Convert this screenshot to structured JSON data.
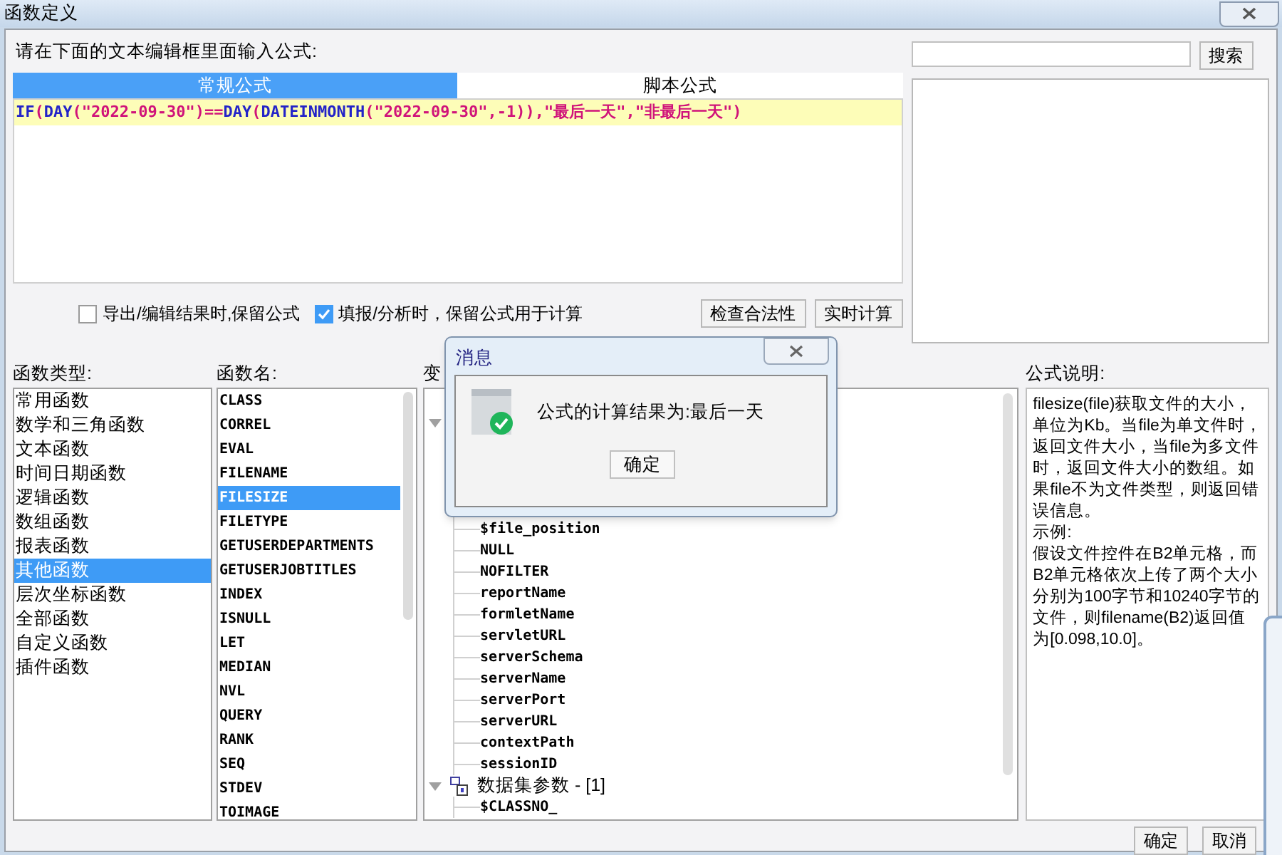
{
  "window": {
    "title": "函数定义"
  },
  "prompt": "请在下面的文本编辑框里面输入公式:",
  "tabs": [
    {
      "label": "常规公式",
      "selected": true
    },
    {
      "label": "脚本公式",
      "selected": false
    }
  ],
  "formula": [
    {
      "kind": "keyword",
      "text": "IF"
    },
    {
      "kind": "symbol",
      "text": "("
    },
    {
      "kind": "keyword",
      "text": "DAY"
    },
    {
      "kind": "symbol",
      "text": "("
    },
    {
      "kind": "string",
      "text": "\"2022-09-30\""
    },
    {
      "kind": "symbol",
      "text": ")=="
    },
    {
      "kind": "keyword",
      "text": "DAY"
    },
    {
      "kind": "symbol",
      "text": "("
    },
    {
      "kind": "keyword",
      "text": "DATEINMONTH"
    },
    {
      "kind": "symbol",
      "text": "("
    },
    {
      "kind": "string",
      "text": "\"2022-09-30\""
    },
    {
      "kind": "symbol",
      "text": ",-1)),"
    },
    {
      "kind": "string",
      "text": "\"最后一天\""
    },
    {
      "kind": "symbol",
      "text": ","
    },
    {
      "kind": "string",
      "text": "\"非最后一天\""
    },
    {
      "kind": "symbol",
      "text": ")"
    }
  ],
  "search": {
    "button": "搜索"
  },
  "options": [
    {
      "label": "导出/编辑结果时,保留公式",
      "checked": false
    },
    {
      "label": "填报/分析时，保留公式用于计算",
      "checked": true
    }
  ],
  "actions": [
    "检查合法性",
    "实时计算"
  ],
  "function_types": {
    "label": "函数类型:",
    "items": [
      {
        "label": "常用函数",
        "selected": false
      },
      {
        "label": "数学和三角函数",
        "selected": false
      },
      {
        "label": "文本函数",
        "selected": false
      },
      {
        "label": "时间日期函数",
        "selected": false
      },
      {
        "label": "逻辑函数",
        "selected": false
      },
      {
        "label": "数组函数",
        "selected": false
      },
      {
        "label": "报表函数",
        "selected": false
      },
      {
        "label": "其他函数",
        "selected": true
      },
      {
        "label": "层次坐标函数",
        "selected": false
      },
      {
        "label": "全部函数",
        "selected": false
      },
      {
        "label": "自定义函数",
        "selected": false
      },
      {
        "label": "插件函数",
        "selected": false
      }
    ]
  },
  "function_names": {
    "label": "函数名:",
    "items": [
      {
        "label": "CLASS",
        "selected": false
      },
      {
        "label": "CORREL",
        "selected": false
      },
      {
        "label": "EVAL",
        "selected": false
      },
      {
        "label": "FILENAME",
        "selected": false
      },
      {
        "label": "FILESIZE",
        "selected": true
      },
      {
        "label": "FILETYPE",
        "selected": false
      },
      {
        "label": "GETUSERDEPARTMENTS",
        "selected": false
      },
      {
        "label": "GETUSERJOBTITLES",
        "selected": false
      },
      {
        "label": "INDEX",
        "selected": false
      },
      {
        "label": "ISNULL",
        "selected": false
      },
      {
        "label": "LET",
        "selected": false
      },
      {
        "label": "MEDIAN",
        "selected": false
      },
      {
        "label": "NVL",
        "selected": false
      },
      {
        "label": "QUERY",
        "selected": false
      },
      {
        "label": "RANK",
        "selected": false
      },
      {
        "label": "SEQ",
        "selected": false
      },
      {
        "label": "STDEV",
        "selected": false
      },
      {
        "label": "TOIMAGE",
        "selected": false
      }
    ]
  },
  "variables": {
    "label": "变",
    "groups": [
      {
        "expanded": true,
        "children": [
          "$file_position",
          "NULL",
          "NOFILTER",
          "reportName",
          "formletName",
          "servletURL",
          "serverSchema",
          "serverName",
          "serverPort",
          "serverURL",
          "contextPath",
          "sessionID"
        ]
      },
      {
        "label": "数据集参数 - [1]",
        "expanded": true,
        "children": [
          "$CLASSNO_"
        ]
      }
    ]
  },
  "description": {
    "label": "公式说明:",
    "paragraphs": [
      "filesize(file)获取文件的大小，单位为Kb。当file为单文件时，返回文件大小，当file为多文件时，返回文件大小的数组。如果file不为文件类型，则返回错误信息。",
      "示例:",
      "假设文件控件在B2单元格，而B2单元格依次上传了两个大小分别为100字节和10240字节的文件，则filename(B2)返回值为[0.098,10.0]。"
    ]
  },
  "buttons": [
    "确定",
    "取消"
  ],
  "message": {
    "title": "消息",
    "text": "公式的计算结果为:最后一天",
    "button": "确定"
  }
}
